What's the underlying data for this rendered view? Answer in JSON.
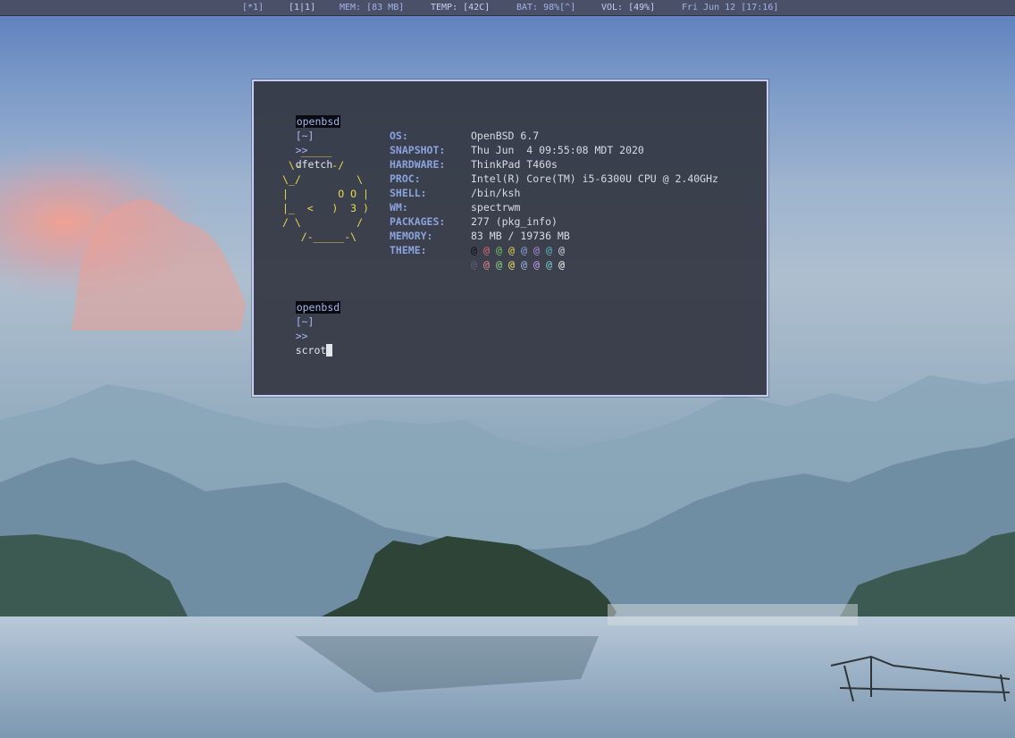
{
  "statusbar": {
    "workspace": "[*1]",
    "layout": "[1|1]",
    "mem": "MEM: [83 MB]",
    "temp": "TEMP: [42C]",
    "bat": "BAT: 98%[^]",
    "vol": "VOL: [49%]",
    "clock": "Fri Jun 12 [17:16]"
  },
  "terminal": {
    "prompt_host": "openbsd",
    "prompt_dir": "[~]",
    "prompt_arrow": ">>",
    "command1": "dfetch",
    "command2": "scrot",
    "ascii_art": "   _____\n \\-     -/\n\\_/         \\\n|        O O |\n|_  <   )  3 )\n/ \\         /\n   /-_____-\\",
    "info": [
      {
        "key": "OS:",
        "value": "OpenBSD 6.7"
      },
      {
        "key": "SNAPSHOT:",
        "value": "Thu Jun  4 09:55:08 MDT 2020"
      },
      {
        "key": "HARDWARE:",
        "value": "ThinkPad T460s"
      },
      {
        "key": "PROC:",
        "value": "Intel(R) Core(TM) i5-6300U CPU @ 2.40GHz"
      },
      {
        "key": "SHELL:",
        "value": "/bin/ksh"
      },
      {
        "key": "WM:",
        "value": "spectrwm"
      },
      {
        "key": "PACKAGES:",
        "value": "277 (pkg_info)"
      },
      {
        "key": "MEMORY:",
        "value": "83 MB / 19736 MB"
      },
      {
        "key": "THEME:",
        "value": ""
      }
    ],
    "theme_glyph": "@",
    "theme_row1_colors": [
      "#0d0e12",
      "#e06c6c",
      "#78c46a",
      "#e6d94e",
      "#8ba3dd",
      "#b48ee0",
      "#5fb8c4",
      "#d8dbe4"
    ],
    "theme_row2_colors": [
      "#5c6378",
      "#ef8a8a",
      "#93dd84",
      "#f2e46c",
      "#a5baf0",
      "#c9a6f0",
      "#7dd1dc",
      "#ffffff"
    ]
  }
}
